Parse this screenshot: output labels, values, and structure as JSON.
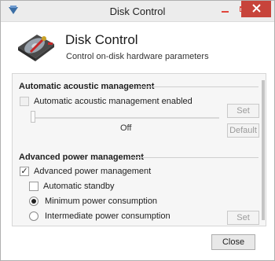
{
  "window": {
    "title": "Disk Control",
    "app_icon": "disk-icon",
    "controls": [
      "minimize-icon",
      "maximize-icon",
      "close-icon"
    ]
  },
  "header": {
    "title": "Disk Control",
    "subtitle": "Control on-disk hardware parameters",
    "icon": "hard-disk-icon"
  },
  "acoustic": {
    "section_title": "Automatic acoustic management",
    "checkbox_label": "Automatic acoustic management enabled",
    "checkbox_checked": false,
    "slider_value_label": "Off",
    "slider_level": 0,
    "set_label": "Set",
    "default_label": "Default"
  },
  "power": {
    "section_title": "Advanced power management",
    "checkbox_label": "Advanced power management",
    "checkbox_checked": true,
    "standby_label": "Automatic standby",
    "standby_checked": false,
    "radio_min_label": "Minimum power consumption",
    "radio_min_selected": true,
    "radio_inter_label": "Intermediate power consumption",
    "radio_inter_selected": false,
    "set_label": "Set"
  },
  "footer": {
    "close_label": "Close"
  },
  "colors": {
    "close_button": "#c7443b",
    "accent_red": "#e0453b",
    "panel_bg": "#f6f6f6"
  }
}
